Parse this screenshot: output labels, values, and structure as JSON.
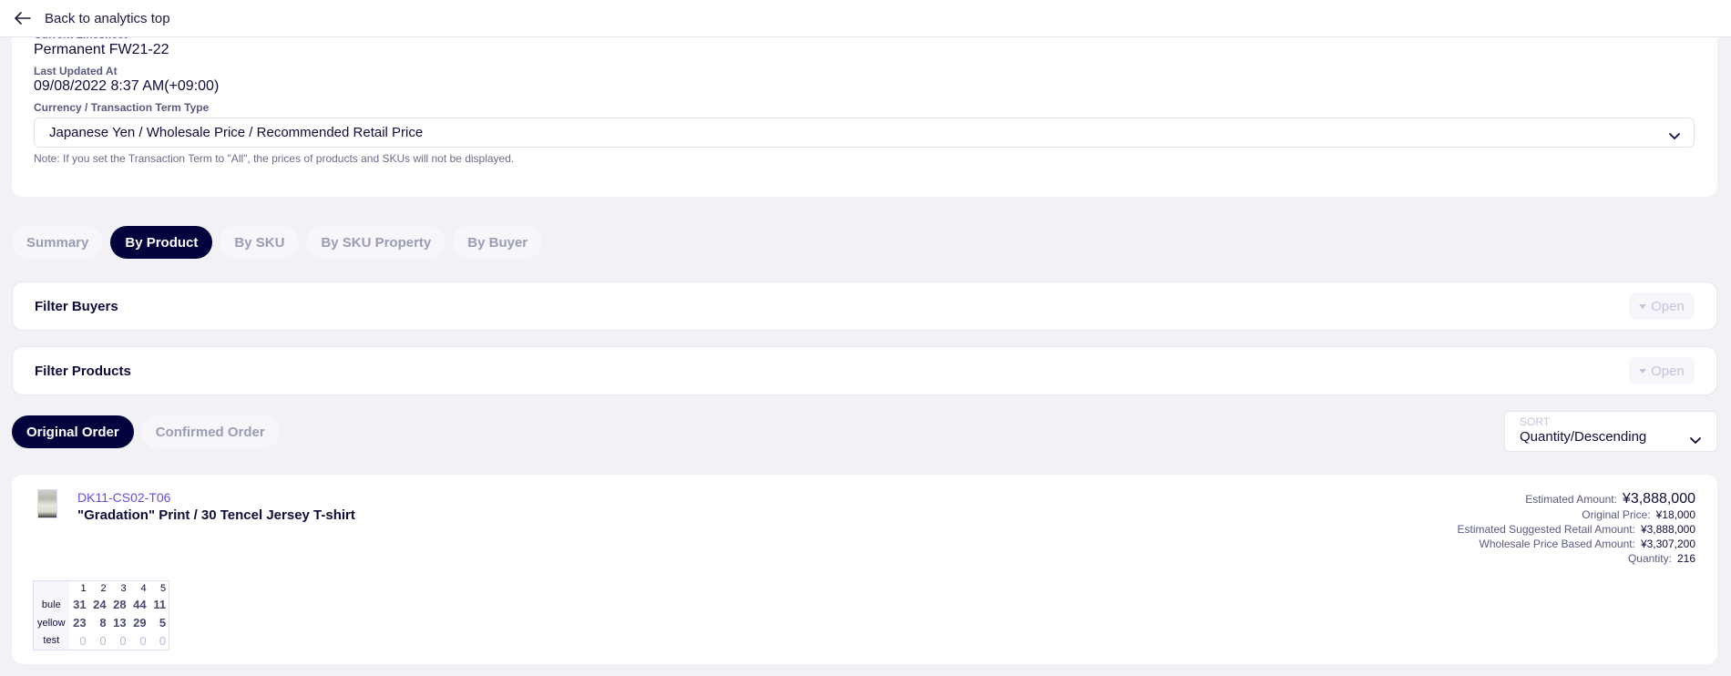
{
  "topbar": {
    "back_icon": "arrow-left-icon",
    "back_label": "Back to analytics top"
  },
  "info": {
    "linesheet_label": "Current Linesheet",
    "linesheet_value": "Permanent FW21-22",
    "updated_label": "Last Updated At",
    "updated_value": "09/08/2022 8:37 AM(+09:00)",
    "currency_label": "Currency / Transaction Term Type",
    "currency_value": "Japanese Yen / Wholesale Price / Recommended Retail Price",
    "currency_icon": "chevron-down-icon",
    "note": "Note: If you set the Transaction Term to \"All\", the prices of products and SKUs will not be displayed."
  },
  "tabs": [
    {
      "label": "Summary",
      "active": false
    },
    {
      "label": "By Product",
      "active": true
    },
    {
      "label": "By SKU",
      "active": false
    },
    {
      "label": "By SKU Property",
      "active": false
    },
    {
      "label": "By Buyer",
      "active": false
    }
  ],
  "filters": {
    "buyers_title": "Filter Buyers",
    "products_title": "Filter Products",
    "open_label": "Open",
    "open_icon": "caret-down-icon"
  },
  "order_tabs": [
    {
      "label": "Original Order",
      "active": true
    },
    {
      "label": "Confirmed Order",
      "active": false
    }
  ],
  "sort": {
    "label": "SORT",
    "value": "Quantity/Descending",
    "icon": "chevron-down-icon"
  },
  "product": {
    "code": "DK11-CS02-T06",
    "name": "\"Gradation\" Print / 30 Tencel Jersey T-shirt",
    "thumbnail": "product-thumbnail",
    "amounts": [
      {
        "label": "Estimated Amount:",
        "value": "¥3,888,000"
      },
      {
        "label": "Original Price:",
        "value": "¥18,000"
      },
      {
        "label": "Estimated Suggested Retail Amount:",
        "value": "¥3,888,000"
      },
      {
        "label": "Wholesale Price Based Amount:",
        "value": "¥3,307,200"
      },
      {
        "label": "Quantity:",
        "value": "216"
      }
    ],
    "sku_table": {
      "columns": [
        "1",
        "2",
        "3",
        "4",
        "5"
      ],
      "rows": [
        {
          "color": "bule",
          "values": [
            "31",
            "24",
            "28",
            "44",
            "11"
          ]
        },
        {
          "color": "yellow",
          "values": [
            "23",
            "8",
            "13",
            "29",
            "5"
          ]
        },
        {
          "color": "test",
          "values": [
            "0",
            "0",
            "0",
            "0",
            "0"
          ]
        }
      ]
    }
  }
}
